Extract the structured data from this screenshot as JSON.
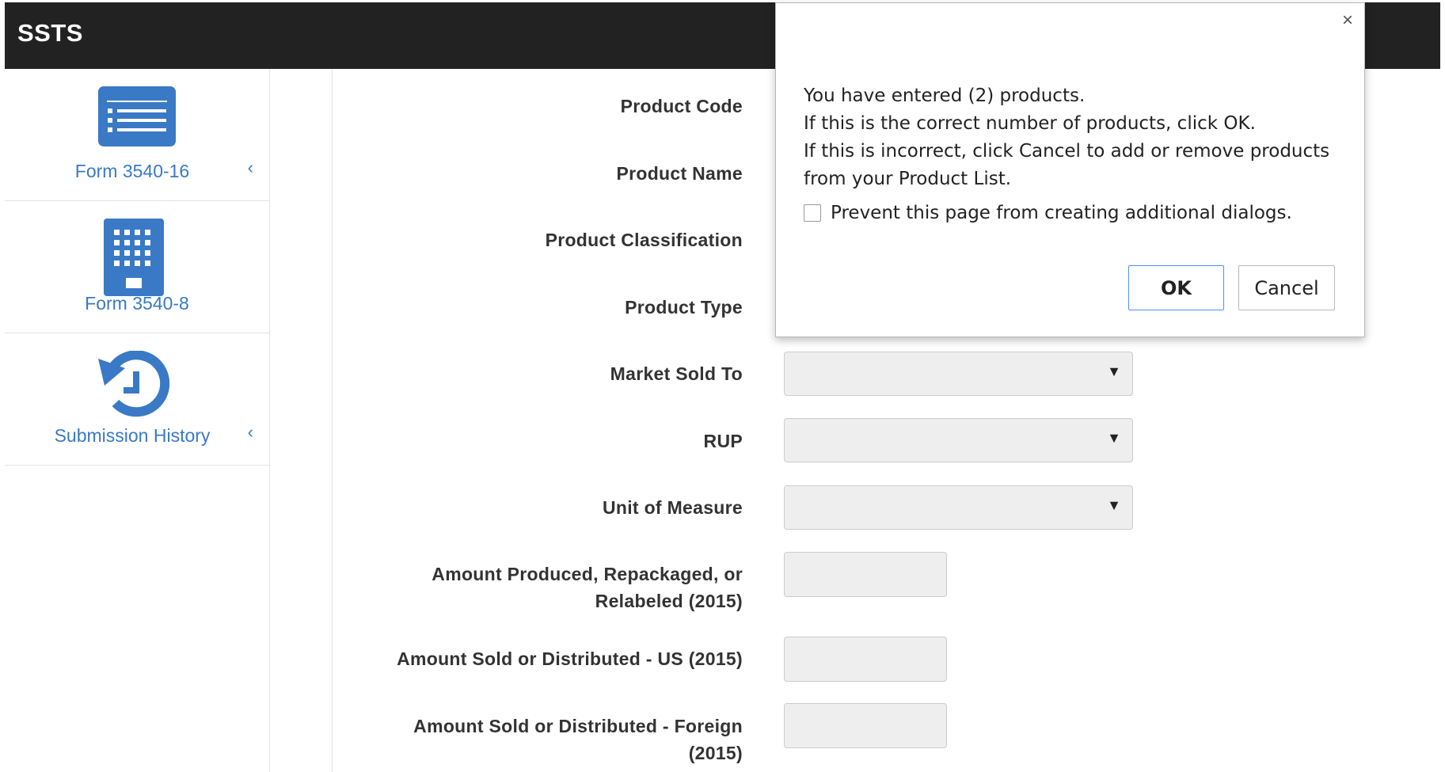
{
  "app": {
    "title": "SSTS"
  },
  "sidebar": {
    "items": [
      {
        "label": "Form 3540-16",
        "icon": "list-icon",
        "has_chevron": true
      },
      {
        "label": "Form 3540-8",
        "icon": "building-icon",
        "has_chevron": false
      },
      {
        "label": "Submission History",
        "icon": "history-icon",
        "has_chevron": true
      }
    ],
    "chevron": "‹"
  },
  "form": {
    "labels": {
      "product_code": "Product Code",
      "product_name": "Product Name",
      "product_classification": "Product Classification",
      "product_type": "Product Type",
      "market_sold_to": "Market Sold To",
      "rup": "RUP",
      "unit_of_measure": "Unit of Measure",
      "amount_produced_line1": "Amount Produced, Repackaged, or",
      "amount_produced_line2": "Relabeled (2015)",
      "amount_sold_us": "Amount Sold or Distributed - US (2015)",
      "amount_sold_foreign_line1": "Amount Sold or Distributed - Foreign",
      "amount_sold_foreign_line2": "(2015)"
    },
    "values": {
      "market_sold_to": "",
      "rup": "",
      "unit_of_measure": "",
      "amount_produced": "",
      "amount_sold_us": "",
      "amount_sold_foreign": ""
    },
    "caret": "▼"
  },
  "dialog": {
    "close": "×",
    "lines": [
      "You have entered (2) products.",
      "If this is the correct number of products, click OK.",
      "If this is incorrect, click Cancel to add or remove products",
      "from your Product List."
    ],
    "checkbox_label": "Prevent this page from creating additional dialogs.",
    "ok_label": "OK",
    "cancel_label": "Cancel"
  },
  "colors": {
    "header_bg": "#222222",
    "link_blue": "#3a79c5",
    "field_bg": "#eeeeee",
    "ok_border": "#4d90fe"
  }
}
